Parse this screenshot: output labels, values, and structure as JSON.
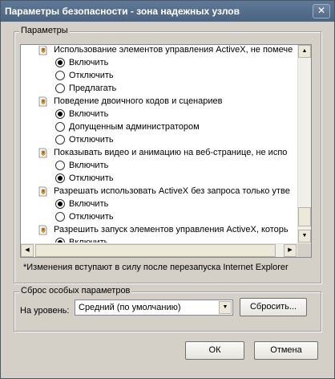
{
  "window": {
    "title": "Параметры безопасности - зона надежных узлов",
    "close_glyph": "✕"
  },
  "settings_group": {
    "legend": "Параметры",
    "items": [
      {
        "kind": "category",
        "label": "Использование элементов управления ActiveX, не помече"
      },
      {
        "kind": "option",
        "label": "Включить",
        "checked": true
      },
      {
        "kind": "option",
        "label": "Отключить",
        "checked": false
      },
      {
        "kind": "option",
        "label": "Предлагать",
        "checked": false
      },
      {
        "kind": "category",
        "label": "Поведение двоичного кодов и сценариев"
      },
      {
        "kind": "option",
        "label": "Включить",
        "checked": true
      },
      {
        "kind": "option",
        "label": "Допущенным администратором",
        "checked": false
      },
      {
        "kind": "option",
        "label": "Отключить",
        "checked": false
      },
      {
        "kind": "category",
        "label": "Показывать видео и анимацию на веб-странице, не испо"
      },
      {
        "kind": "option",
        "label": "Включить",
        "checked": false
      },
      {
        "kind": "option",
        "label": "Отключить",
        "checked": true
      },
      {
        "kind": "category",
        "label": "Разрешать использовать ActiveX без запроса только утве"
      },
      {
        "kind": "option",
        "label": "Включить",
        "checked": true
      },
      {
        "kind": "option",
        "label": "Отключить",
        "checked": false
      },
      {
        "kind": "category",
        "label": "Разрешить запуск элементов управления ActiveX, которь"
      },
      {
        "kind": "option",
        "label": "Включить",
        "checked": true
      }
    ],
    "note": "*Изменения вступают в силу после перезапуска Internet Explorer"
  },
  "reset_group": {
    "legend": "Сброс особых параметров",
    "level_label": "На уровень:",
    "level_value": "Средний (по умолчанию)",
    "reset_button": "Сбросить..."
  },
  "footer": {
    "ok_button": "ОК",
    "cancel_button": "Отмена"
  },
  "icons": {
    "category": "security-setting-icon",
    "scroll_up": "scroll-up-arrow-icon",
    "scroll_down": "scroll-down-arrow-icon",
    "scroll_left": "scroll-left-arrow-icon",
    "scroll_right": "scroll-right-arrow-icon",
    "dropdown": "dropdown-arrow-icon"
  }
}
